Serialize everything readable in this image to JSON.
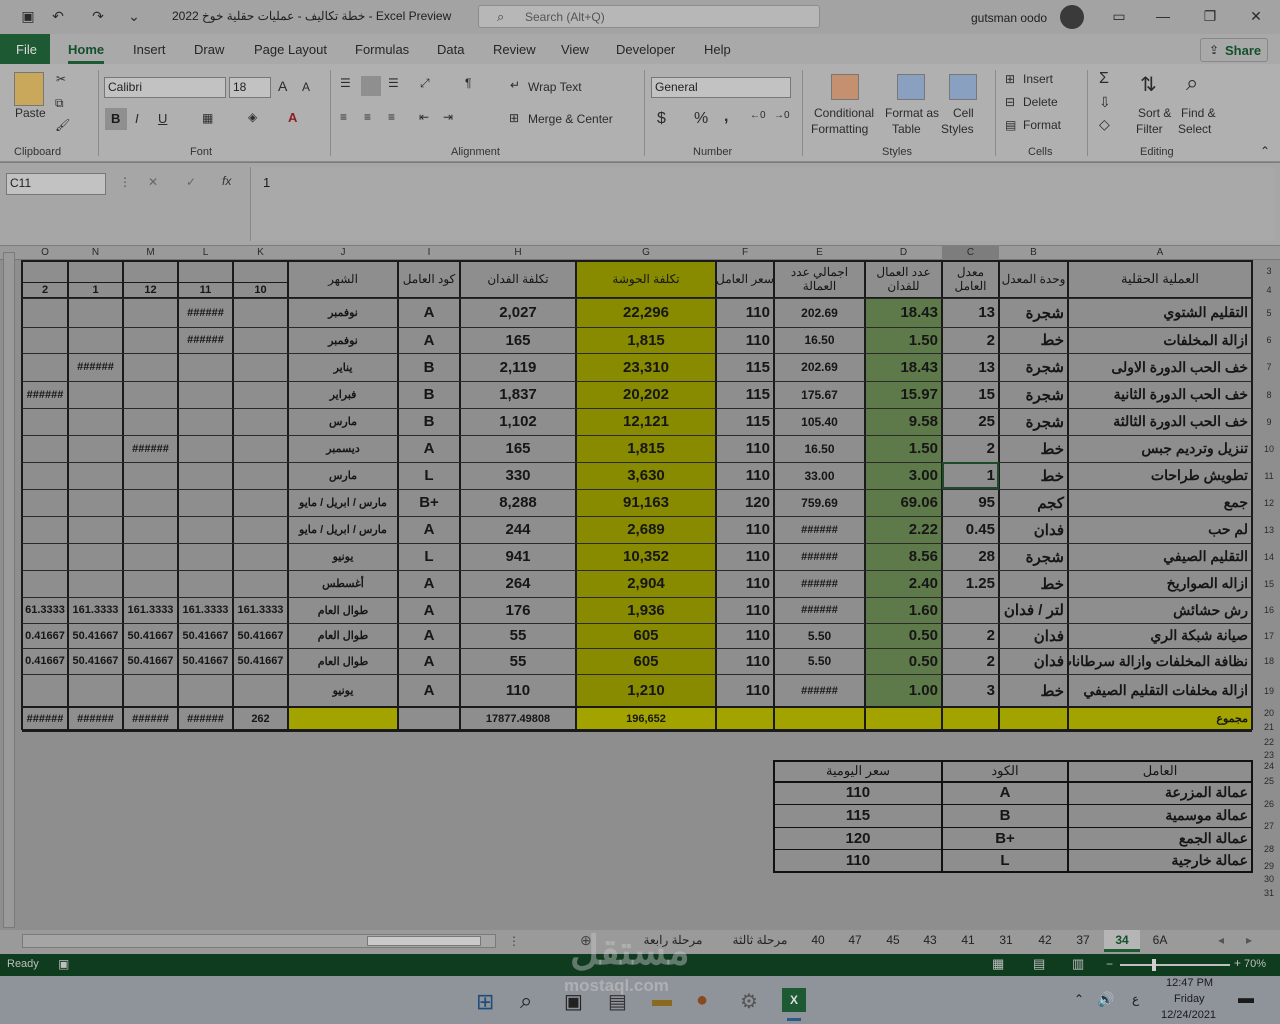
{
  "app": {
    "title": "خطة تكاليف - عمليات حقلية خوخ 2022  -  Excel Preview",
    "search_placeholder": "Search (Alt+Q)",
    "user": "gutsman oodo"
  },
  "ribbon_tabs": [
    "File",
    "Home",
    "Insert",
    "Draw",
    "Page Layout",
    "Formulas",
    "Data",
    "Review",
    "View",
    "Developer",
    "Help"
  ],
  "share_label": "Share",
  "clipboard": {
    "paste": "Paste",
    "label": "Clipboard"
  },
  "font": {
    "name": "Calibri",
    "size": "18",
    "label": "Font",
    "bold": "B",
    "italic": "I",
    "underline": "U"
  },
  "alignment": {
    "wrap": "Wrap Text",
    "merge": "Merge & Center",
    "label": "Alignment"
  },
  "number": {
    "format": "General",
    "label": "Number",
    "currency": "$",
    "percent": "%",
    "comma": ","
  },
  "styles": {
    "conditional": "Conditional",
    "conditional2": "Formatting",
    "format_table": "Format as",
    "format_table2": "Table",
    "cell_styles": "Cell",
    "cell_styles2": "Styles",
    "label": "Styles"
  },
  "cells": {
    "insert": "Insert",
    "delete": "Delete",
    "format": "Format",
    "label": "Cells"
  },
  "editing": {
    "sort": "Sort &",
    "sort2": "Filter",
    "find": "Find &",
    "find2": "Select",
    "label": "Editing"
  },
  "formula_bar": {
    "name_box": "C11",
    "fx": "fx",
    "value": "1"
  },
  "columns": [
    "O",
    "N",
    "M",
    "L",
    "K",
    "J",
    "I",
    "H",
    "G",
    "F",
    "E",
    "D",
    "C",
    "B",
    "A"
  ],
  "row_numbers": [
    "3",
    "4",
    "5",
    "6",
    "7",
    "8",
    "9",
    "10",
    "11",
    "12",
    "13",
    "14",
    "15",
    "16",
    "17",
    "18",
    "19",
    "20",
    "21",
    "22",
    "23",
    "24",
    "25",
    "26",
    "27",
    "28",
    "29",
    "30",
    "31"
  ],
  "headers": {
    "a": "العملية الحقلية",
    "b": "وحدة المعدل",
    "c": "معدل العامل",
    "d": "عدد العمال للفدان",
    "e": "اجمالي عدد العمالة",
    "f": "سعر العامل",
    "g": "تكلفة الحوشة",
    "h": "تكلفة الفدان",
    "i": "كود العامل",
    "j": "الشهر",
    "months": [
      "10",
      "11",
      "12",
      "1",
      "2"
    ]
  },
  "rows": [
    {
      "a": "التقليم الشتوي",
      "b": "شجرة",
      "c": "13",
      "d": "18.43",
      "e": "202.69",
      "f": "110",
      "g": "22,296",
      "h": "2,027",
      "i": "A",
      "j": "نوفمبر",
      "k": "",
      "l": "######",
      "m": "",
      "n": "",
      "o": ""
    },
    {
      "a": "ازالة المخلفات",
      "b": "خط",
      "c": "2",
      "d": "1.50",
      "e": "16.50",
      "f": "110",
      "g": "1,815",
      "h": "165",
      "i": "A",
      "j": "نوفمبر",
      "k": "",
      "l": "######",
      "m": "",
      "n": "",
      "o": ""
    },
    {
      "a": "خف الحب الدورة الاولى",
      "b": "شجرة",
      "c": "13",
      "d": "18.43",
      "e": "202.69",
      "f": "115",
      "g": "23,310",
      "h": "2,119",
      "i": "B",
      "j": "يناير",
      "k": "",
      "l": "",
      "m": "",
      "n": "######",
      "o": ""
    },
    {
      "a": "خف الحب الدورة الثانية",
      "b": "شجرة",
      "c": "15",
      "d": "15.97",
      "e": "175.67",
      "f": "115",
      "g": "20,202",
      "h": "1,837",
      "i": "B",
      "j": "فبراير",
      "k": "",
      "l": "",
      "m": "",
      "n": "",
      "o": "######"
    },
    {
      "a": "خف الحب الدورة الثالثة",
      "b": "شجرة",
      "c": "25",
      "d": "9.58",
      "e": "105.40",
      "f": "115",
      "g": "12,121",
      "h": "1,102",
      "i": "B",
      "j": "مارس",
      "k": "",
      "l": "",
      "m": "",
      "n": "",
      "o": ""
    },
    {
      "a": "تنزيل وترديم جبس",
      "b": "خط",
      "c": "2",
      "d": "1.50",
      "e": "16.50",
      "f": "110",
      "g": "1,815",
      "h": "165",
      "i": "A",
      "j": "ديسمبر",
      "k": "",
      "l": "",
      "m": "######",
      "n": "",
      "o": ""
    },
    {
      "a": "تطويش طراحات",
      "b": "خط",
      "c": "1",
      "d": "3.00",
      "e": "33.00",
      "f": "110",
      "g": "3,630",
      "h": "330",
      "i": "L",
      "j": "مارس",
      "k": "",
      "l": "",
      "m": "",
      "n": "",
      "o": ""
    },
    {
      "a": "جمع",
      "b": "كجم",
      "c": "95",
      "d": "69.06",
      "e": "759.69",
      "f": "120",
      "g": "91,163",
      "h": "8,288",
      "i": "B+",
      "j": "مارس / ابريل / مايو",
      "k": "",
      "l": "",
      "m": "",
      "n": "",
      "o": ""
    },
    {
      "a": "لم حب",
      "b": "فدان",
      "c": "0.45",
      "d": "2.22",
      "e": "######",
      "f": "110",
      "g": "2,689",
      "h": "244",
      "i": "A",
      "j": "مارس / ابريل / مايو",
      "k": "",
      "l": "",
      "m": "",
      "n": "",
      "o": ""
    },
    {
      "a": "التقليم الصيفي",
      "b": "شجرة",
      "c": "28",
      "d": "8.56",
      "e": "######",
      "f": "110",
      "g": "10,352",
      "h": "941",
      "i": "L",
      "j": "يونيو",
      "k": "",
      "l": "",
      "m": "",
      "n": "",
      "o": ""
    },
    {
      "a": "ازاله الصواريخ",
      "b": "خط",
      "c": "1.25",
      "d": "2.40",
      "e": "######",
      "f": "110",
      "g": "2,904",
      "h": "264",
      "i": "A",
      "j": "أغسطس",
      "k": "",
      "l": "",
      "m": "",
      "n": "",
      "o": ""
    },
    {
      "a": "رش حشائش",
      "b": "لتر / فدان",
      "c": "",
      "d": "1.60",
      "e": "######",
      "f": "110",
      "g": "1,936",
      "h": "176",
      "i": "A",
      "j": "طوال العام",
      "k": "161.3333",
      "l": "161.3333",
      "m": "161.3333",
      "n": "161.3333",
      "o": "61.3333"
    },
    {
      "a": "صيانة شبكة الري",
      "b": "فدان",
      "c": "2",
      "d": "0.50",
      "e": "5.50",
      "f": "110",
      "g": "605",
      "h": "55",
      "i": "A",
      "j": "طوال العام",
      "k": "50.41667",
      "l": "50.41667",
      "m": "50.41667",
      "n": "50.41667",
      "o": "0.41667"
    },
    {
      "a": "نظافة المخلفات وازالة سرطانات",
      "b": "فدان",
      "c": "2",
      "d": "0.50",
      "e": "5.50",
      "f": "110",
      "g": "605",
      "h": "55",
      "i": "A",
      "j": "طوال العام",
      "k": "50.41667",
      "l": "50.41667",
      "m": "50.41667",
      "n": "50.41667",
      "o": "0.41667"
    },
    {
      "a": "ازالة مخلفات التقليم الصيفي",
      "b": "خط",
      "c": "3",
      "d": "1.00",
      "e": "######",
      "f": "110",
      "g": "1,210",
      "h": "110",
      "i": "A",
      "j": "يونيو",
      "k": "",
      "l": "",
      "m": "",
      "n": "",
      "o": ""
    }
  ],
  "total_row": {
    "a": "مجموع",
    "g": "196,652",
    "h": "17877.49808",
    "k": "262",
    "l": "######",
    "m": "######",
    "n": "######",
    "o": "######"
  },
  "legend": {
    "h_worker": "العامل",
    "h_code": "الكود",
    "h_rate": "سعر اليومية",
    "rows": [
      {
        "worker": "عمالة المزرعة",
        "code": "A",
        "rate": "110"
      },
      {
        "worker": "عمالة موسمية",
        "code": "B",
        "rate": "115"
      },
      {
        "worker": "عمالة الجمع",
        "code": "B+",
        "rate": "120"
      },
      {
        "worker": "عمالة خارجية",
        "code": "L",
        "rate": "110"
      }
    ]
  },
  "sheet_tabs": [
    "6A",
    "34",
    "37",
    "42",
    "31",
    "41",
    "43",
    "45",
    "47",
    "40",
    "مرحلة ثالثة",
    "مرحلة رابعة"
  ],
  "active_sheet": "34",
  "status": {
    "ready": "Ready",
    "zoom": "70%"
  },
  "clock": {
    "time": "12:47 PM",
    "day": "Friday",
    "date": "12/24/2021"
  },
  "watermark": {
    "ar": "مستقل",
    "en": "mostaql.com"
  },
  "colors": {
    "olive": "#888a00",
    "yellow": "#a3a300",
    "green_d": "#5f7a4a",
    "excel_green": "#1d5a34"
  }
}
